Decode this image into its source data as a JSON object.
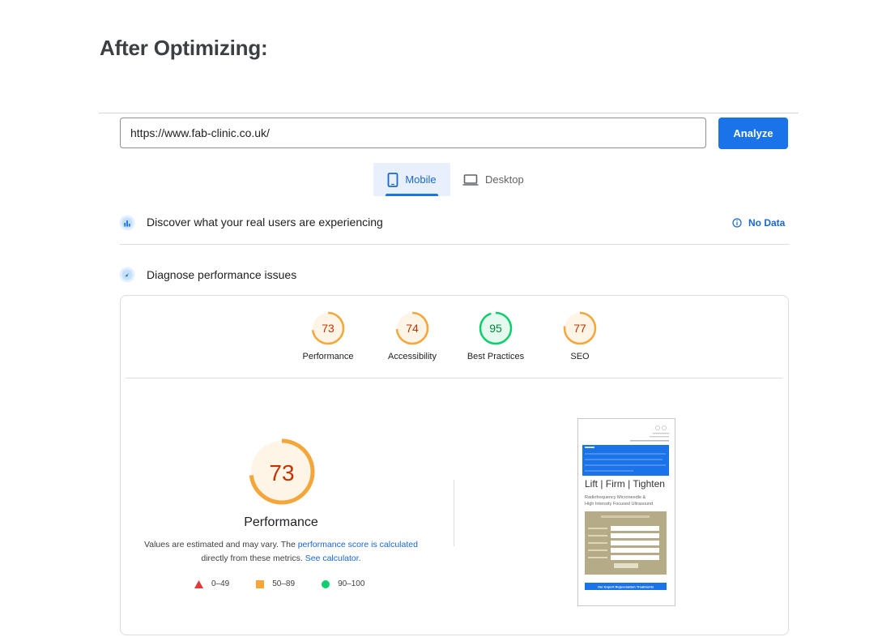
{
  "heading": "After Optimizing:",
  "search": {
    "url": "https://www.fab-clinic.co.uk/",
    "analyze_label": "Analyze"
  },
  "tabs": [
    {
      "label": "Mobile",
      "active": true
    },
    {
      "label": "Desktop",
      "active": false
    }
  ],
  "sections": {
    "discover": {
      "title": "Discover what your real users are experiencing",
      "status": "No Data"
    },
    "diagnose": {
      "title": "Diagnose performance issues"
    }
  },
  "scores": [
    {
      "label": "Performance",
      "value": 73,
      "status": "average"
    },
    {
      "label": "Accessibility",
      "value": 74,
      "status": "average"
    },
    {
      "label": "Best Practices",
      "value": 95,
      "status": "pass"
    },
    {
      "label": "SEO",
      "value": 77,
      "status": "average"
    }
  ],
  "main": {
    "score": 73,
    "label": "Performance",
    "note_prefix": "Values are estimated and may vary. The ",
    "note_link": "performance score is calculated",
    "note_mid": "directly from these metrics. ",
    "note_link2": "See calculator."
  },
  "legend": [
    {
      "range": "0–49",
      "shape": "triangle",
      "color": "#e53935"
    },
    {
      "range": "50–89",
      "shape": "square",
      "color": "#f4a63a"
    },
    {
      "range": "90–100",
      "shape": "circle",
      "color": "#0cce6b"
    }
  ],
  "screenshot": {
    "headline": "Lift | Firm | Tighten",
    "subline1": "Radiofrequency Microneedle &",
    "subline2": "High Intensity Focused Ultrasound",
    "cta": "Our Expert Rejuvenation Treatments"
  },
  "colors": {
    "average_stroke": "#f4a63a",
    "average_fill": "#fff5e6",
    "average_text": "#c33300",
    "pass_stroke": "#0cce6b",
    "pass_fill": "#e6f9ef",
    "pass_text": "#018642",
    "accent": "#1a73e8"
  }
}
